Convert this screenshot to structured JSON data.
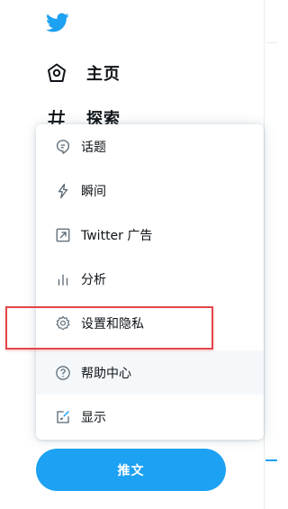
{
  "app": {
    "brand_color": "#1da1f2",
    "logo_icon": "twitter-bird-icon"
  },
  "nav": {
    "items": [
      {
        "label": "主页",
        "icon": "home-icon"
      },
      {
        "label": "探索",
        "icon": "hashtag-icon"
      }
    ]
  },
  "menu": {
    "items": [
      {
        "label": "话题",
        "icon": "topics-icon"
      },
      {
        "label": "瞬间",
        "icon": "moments-icon"
      },
      {
        "label": "Twitter 广告",
        "icon": "ads-icon"
      },
      {
        "label": "分析",
        "icon": "analytics-icon"
      },
      {
        "label": "设置和隐私",
        "icon": "settings-icon"
      },
      {
        "label": "帮助中心",
        "icon": "help-icon"
      },
      {
        "label": "显示",
        "icon": "display-icon"
      }
    ]
  },
  "tweet_button": {
    "label": "推文"
  }
}
